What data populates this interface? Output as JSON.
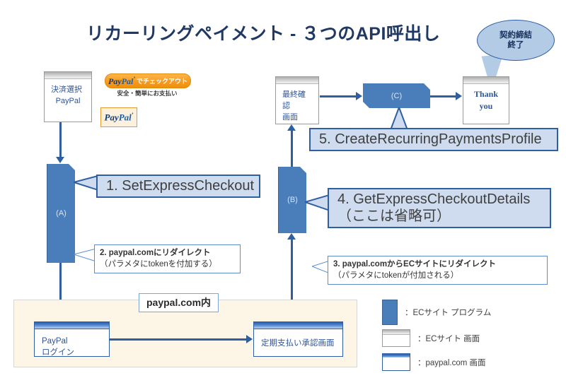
{
  "title": "リカーリングペイメント - ３つのAPI呼出し",
  "bubble": {
    "line1": "契約締結",
    "line2": "終了"
  },
  "screens": {
    "payment_select": {
      "line1": "決済選択",
      "line2": "PayPal"
    },
    "final_confirm": {
      "line1": "最終確認",
      "line2": "画面"
    },
    "thank_you": {
      "label": "Thank you"
    },
    "paypal_login": {
      "line1": "PayPal",
      "line2": "ログイン"
    },
    "recurring_approval": {
      "label": "定期支払い承認画面"
    }
  },
  "paypal_button": {
    "brand_pay": "Pay",
    "brand_pal": "Pal",
    "trademark": "’",
    "label": "でチェックアウト",
    "subtitle": "安全・簡単にお支払い"
  },
  "paypal_logo": {
    "brand_pay": "Pay",
    "brand_pal": "Pal",
    "trademark": "’"
  },
  "processes": {
    "a": "(A)",
    "b": "(B)",
    "c": "(C)"
  },
  "callouts": {
    "step1": "1. SetExpressCheckout",
    "step4_line1": "4. GetExpressCheckoutDetails",
    "step4_line2": "（ここは省略可）",
    "step5": "5. CreateRecurringPaymentsProfile"
  },
  "notes": {
    "step2_line1": "2. paypal.comにリダイレクト",
    "step2_line2": "（パラメタにtokenを付加する）",
    "step3_line1": "3. paypal.comからECサイトにリダイレクト",
    "step3_line2": "（パラメタにtokenが付加される）"
  },
  "container_label": "paypal.com内",
  "legend": [
    {
      "swatch": "process-box",
      "label": "：ECサイト プログラム"
    },
    {
      "swatch": "ec-screen",
      "label": "：ECサイト 画面"
    },
    {
      "swatch": "pp-screen",
      "label": "：paypal.com 画面"
    }
  ],
  "colors": {
    "title": "#1f3864",
    "process_fill": "#4a7ebb",
    "callout_fill": "#cfdcef",
    "callout_border": "#2e5fa3",
    "arrow": "#2f5f9e",
    "container_bg": "#fdf6e7",
    "paypal_orange": "#f79d22",
    "paypal_navy": "#123a72",
    "bubble_fill": "#b4cbe6"
  }
}
